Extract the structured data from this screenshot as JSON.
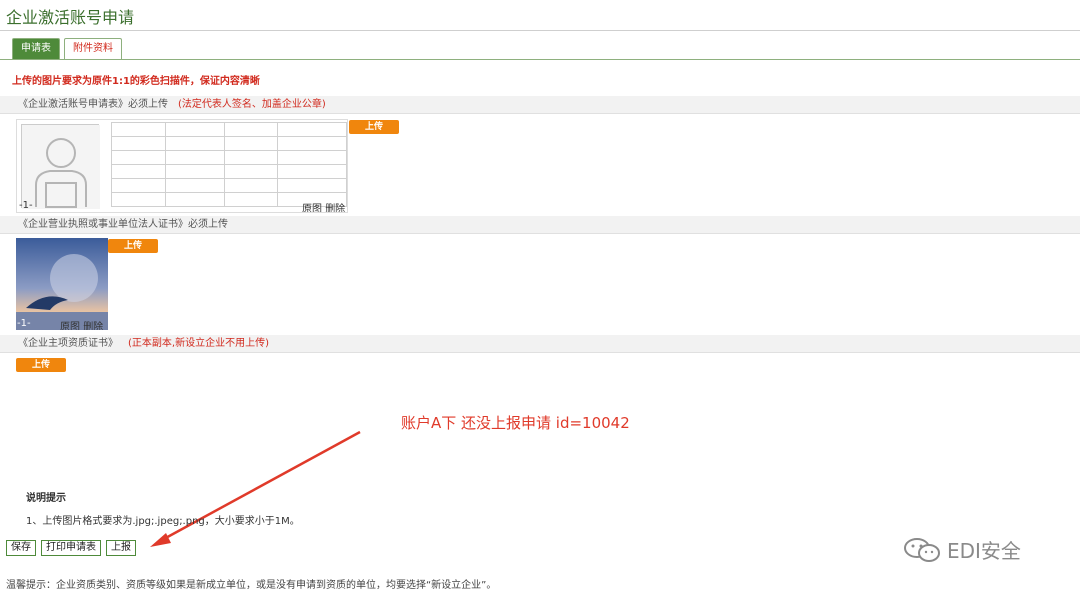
{
  "page": {
    "title": "企业激活账号申请"
  },
  "tabs": [
    {
      "label": "申请表"
    },
    {
      "label": "附件资料"
    }
  ],
  "notice": "上传的图片要求为原件1:1的彩色扫描件，保证内容清晰",
  "sections": [
    {
      "title": "《企业激活账号申请表》",
      "requirement": "必须上传",
      "note": "(法定代表人签名、加盖企业公章)"
    },
    {
      "title": "《企业营业执照或事业单位法人证书》",
      "requirement": "必须上传",
      "note": ""
    },
    {
      "title": "《企业主项资质证书》",
      "requirement": "",
      "note": "(正本副本,新设立企业不用上传)"
    }
  ],
  "upload_label": "上传",
  "thumbnails": [
    {
      "index": "-1-",
      "view_label": "原图",
      "delete_label": "删除"
    },
    {
      "index": "-1-",
      "view_label": "原图",
      "delete_label": "删除"
    }
  ],
  "annotation": "账户A下   还没上报申请  id=10042",
  "tips": {
    "title": "说明提示",
    "item1": "1、上传图片格式要求为.jpg;.jpeg;.png，大小要求小于1M。"
  },
  "buttons": {
    "save": "保存",
    "print": "打印申请表",
    "submit": "上报"
  },
  "warm_tip": "温馨提示：企业资质类别、资质等级如果是新成立单位，或是没有申请到资质的单位，均要选择“新设立企业”。",
  "watermark": "EDI安全",
  "colors": {
    "tab_active": "#4e8a3a",
    "upload": "#f0860d",
    "alert_red": "#d12a1e",
    "annotation_red": "#e03a2a"
  }
}
